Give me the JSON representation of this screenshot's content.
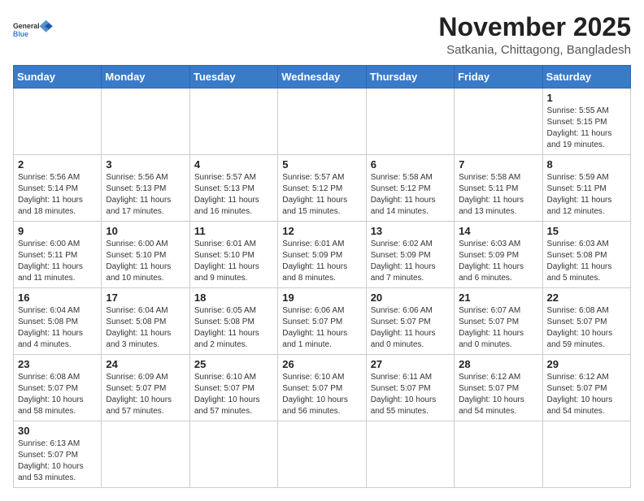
{
  "header": {
    "logo_line1": "General",
    "logo_line2": "Blue",
    "month_title": "November 2025",
    "subtitle": "Satkania, Chittagong, Bangladesh"
  },
  "weekdays": [
    "Sunday",
    "Monday",
    "Tuesday",
    "Wednesday",
    "Thursday",
    "Friday",
    "Saturday"
  ],
  "weeks": [
    [
      {
        "day": "",
        "info": ""
      },
      {
        "day": "",
        "info": ""
      },
      {
        "day": "",
        "info": ""
      },
      {
        "day": "",
        "info": ""
      },
      {
        "day": "",
        "info": ""
      },
      {
        "day": "",
        "info": ""
      },
      {
        "day": "1",
        "info": "Sunrise: 5:55 AM\nSunset: 5:15 PM\nDaylight: 11 hours and 19 minutes."
      }
    ],
    [
      {
        "day": "2",
        "info": "Sunrise: 5:56 AM\nSunset: 5:14 PM\nDaylight: 11 hours and 18 minutes."
      },
      {
        "day": "3",
        "info": "Sunrise: 5:56 AM\nSunset: 5:13 PM\nDaylight: 11 hours and 17 minutes."
      },
      {
        "day": "4",
        "info": "Sunrise: 5:57 AM\nSunset: 5:13 PM\nDaylight: 11 hours and 16 minutes."
      },
      {
        "day": "5",
        "info": "Sunrise: 5:57 AM\nSunset: 5:12 PM\nDaylight: 11 hours and 15 minutes."
      },
      {
        "day": "6",
        "info": "Sunrise: 5:58 AM\nSunset: 5:12 PM\nDaylight: 11 hours and 14 minutes."
      },
      {
        "day": "7",
        "info": "Sunrise: 5:58 AM\nSunset: 5:11 PM\nDaylight: 11 hours and 13 minutes."
      },
      {
        "day": "8",
        "info": "Sunrise: 5:59 AM\nSunset: 5:11 PM\nDaylight: 11 hours and 12 minutes."
      }
    ],
    [
      {
        "day": "9",
        "info": "Sunrise: 6:00 AM\nSunset: 5:11 PM\nDaylight: 11 hours and 11 minutes."
      },
      {
        "day": "10",
        "info": "Sunrise: 6:00 AM\nSunset: 5:10 PM\nDaylight: 11 hours and 10 minutes."
      },
      {
        "day": "11",
        "info": "Sunrise: 6:01 AM\nSunset: 5:10 PM\nDaylight: 11 hours and 9 minutes."
      },
      {
        "day": "12",
        "info": "Sunrise: 6:01 AM\nSunset: 5:09 PM\nDaylight: 11 hours and 8 minutes."
      },
      {
        "day": "13",
        "info": "Sunrise: 6:02 AM\nSunset: 5:09 PM\nDaylight: 11 hours and 7 minutes."
      },
      {
        "day": "14",
        "info": "Sunrise: 6:03 AM\nSunset: 5:09 PM\nDaylight: 11 hours and 6 minutes."
      },
      {
        "day": "15",
        "info": "Sunrise: 6:03 AM\nSunset: 5:08 PM\nDaylight: 11 hours and 5 minutes."
      }
    ],
    [
      {
        "day": "16",
        "info": "Sunrise: 6:04 AM\nSunset: 5:08 PM\nDaylight: 11 hours and 4 minutes."
      },
      {
        "day": "17",
        "info": "Sunrise: 6:04 AM\nSunset: 5:08 PM\nDaylight: 11 hours and 3 minutes."
      },
      {
        "day": "18",
        "info": "Sunrise: 6:05 AM\nSunset: 5:08 PM\nDaylight: 11 hours and 2 minutes."
      },
      {
        "day": "19",
        "info": "Sunrise: 6:06 AM\nSunset: 5:07 PM\nDaylight: 11 hours and 1 minute."
      },
      {
        "day": "20",
        "info": "Sunrise: 6:06 AM\nSunset: 5:07 PM\nDaylight: 11 hours and 0 minutes."
      },
      {
        "day": "21",
        "info": "Sunrise: 6:07 AM\nSunset: 5:07 PM\nDaylight: 11 hours and 0 minutes."
      },
      {
        "day": "22",
        "info": "Sunrise: 6:08 AM\nSunset: 5:07 PM\nDaylight: 10 hours and 59 minutes."
      }
    ],
    [
      {
        "day": "23",
        "info": "Sunrise: 6:08 AM\nSunset: 5:07 PM\nDaylight: 10 hours and 58 minutes."
      },
      {
        "day": "24",
        "info": "Sunrise: 6:09 AM\nSunset: 5:07 PM\nDaylight: 10 hours and 57 minutes."
      },
      {
        "day": "25",
        "info": "Sunrise: 6:10 AM\nSunset: 5:07 PM\nDaylight: 10 hours and 57 minutes."
      },
      {
        "day": "26",
        "info": "Sunrise: 6:10 AM\nSunset: 5:07 PM\nDaylight: 10 hours and 56 minutes."
      },
      {
        "day": "27",
        "info": "Sunrise: 6:11 AM\nSunset: 5:07 PM\nDaylight: 10 hours and 55 minutes."
      },
      {
        "day": "28",
        "info": "Sunrise: 6:12 AM\nSunset: 5:07 PM\nDaylight: 10 hours and 54 minutes."
      },
      {
        "day": "29",
        "info": "Sunrise: 6:12 AM\nSunset: 5:07 PM\nDaylight: 10 hours and 54 minutes."
      }
    ],
    [
      {
        "day": "30",
        "info": "Sunrise: 6:13 AM\nSunset: 5:07 PM\nDaylight: 10 hours and 53 minutes."
      },
      {
        "day": "",
        "info": ""
      },
      {
        "day": "",
        "info": ""
      },
      {
        "day": "",
        "info": ""
      },
      {
        "day": "",
        "info": ""
      },
      {
        "day": "",
        "info": ""
      },
      {
        "day": "",
        "info": ""
      }
    ]
  ]
}
